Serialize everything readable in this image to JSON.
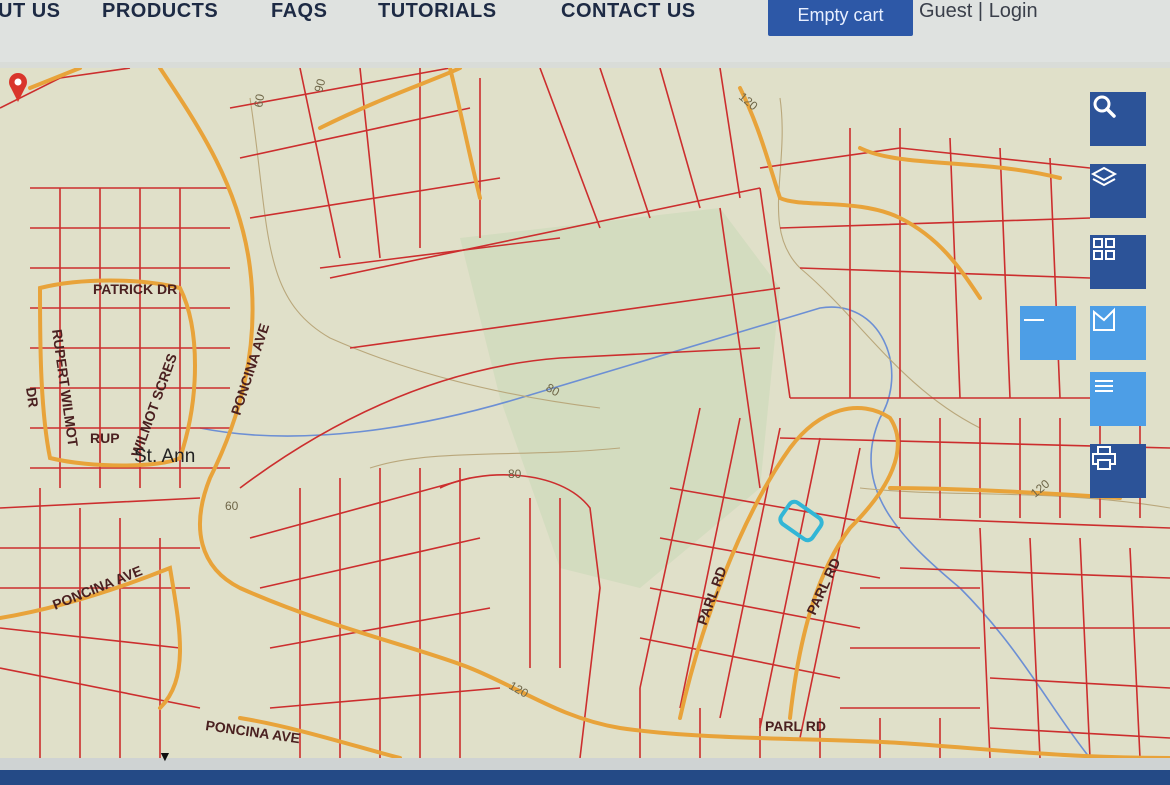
{
  "nav": {
    "items": [
      "UT US",
      "PRODUCTS",
      "FAQS",
      "TUTORIALS",
      "CONTACT US"
    ],
    "cart_label": "Empty cart",
    "guest_label": "Guest",
    "separator": "|",
    "login_label": "Login"
  },
  "map": {
    "street_labels": {
      "patrick": "PATRICK DR",
      "rupert_wilmot": "RUPERT WILMOT",
      "dr": "DR",
      "poncina_ave_v": "PONCINA AVE",
      "wilmot_scres": "WILMOT SCRES",
      "rup": "RUP",
      "st_ann": "St. Ann",
      "poncina_ave_left": "PONCINA AVE",
      "poncina_ave_bottom": "PONCINA AVE",
      "parl_rd_1": "PARL RD",
      "parl_rd_2": "PARL RD",
      "parl_rd_bottom": "PARL RD"
    },
    "contours": {
      "c60": "60",
      "c90": "90",
      "c120_top": "120",
      "c80_mid": "80",
      "c80_low": "80",
      "c60_low": "60",
      "c120_right": "120",
      "c120_bottom": "120"
    }
  },
  "toolbar": {
    "icons": [
      "search-icon",
      "layers-icon",
      "grid-icon",
      "measure-line-icon",
      "measure-area-icon",
      "list-icon",
      "print-icon"
    ]
  },
  "colors": {
    "nav_text": "#1d2a44",
    "cart_bg": "#2d58a7",
    "parcel": "#cc2e2e",
    "road": "#e8a33a",
    "toolbar": "#2c5398",
    "toolbar_light": "#4d9ee6",
    "highlight": "#32b6d6"
  }
}
